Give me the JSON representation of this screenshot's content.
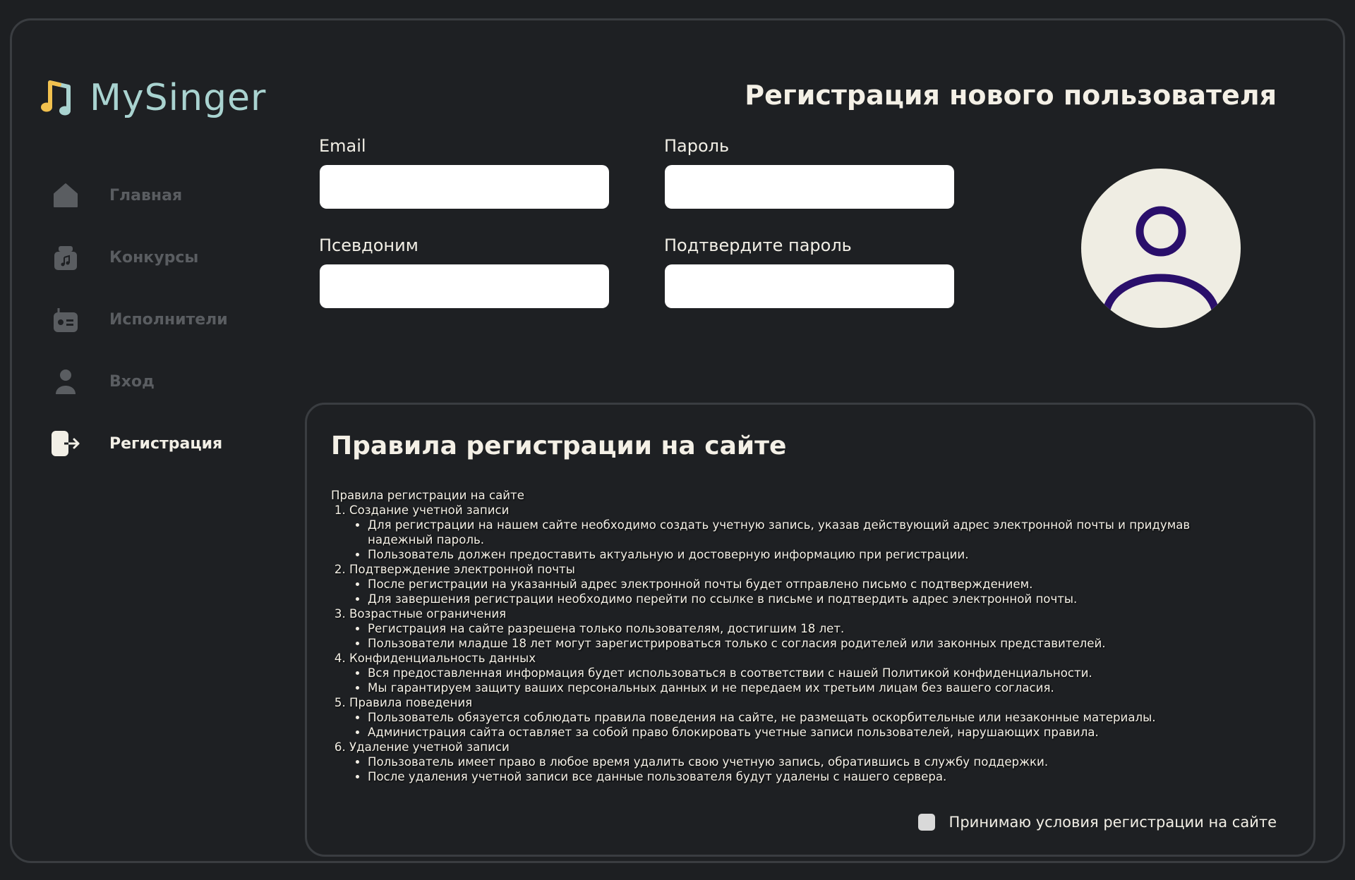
{
  "app": {
    "brand": "MySinger",
    "page_title": "Регистрация нового пользователя"
  },
  "nav": {
    "items": [
      {
        "label": "Главная",
        "icon": "home-icon",
        "active": false
      },
      {
        "label": "Конкурсы",
        "icon": "contest-icon",
        "active": false
      },
      {
        "label": "Исполнители",
        "icon": "radio-icon",
        "active": false
      },
      {
        "label": "Вход",
        "icon": "user-icon",
        "active": false
      },
      {
        "label": "Регистрация",
        "icon": "logout-arrow-icon",
        "active": true
      }
    ]
  },
  "form": {
    "email_label": "Email",
    "email_value": "",
    "password_label": "Пароль",
    "password_value": "",
    "nickname_label": "Псевдоним",
    "nickname_value": "",
    "confirm_label": "Подтвердите пароль",
    "confirm_value": ""
  },
  "rules": {
    "title": "Правила регистрации на сайте",
    "intro": "Правила регистрации на сайте",
    "sections": [
      {
        "heading": "Создание учетной записи",
        "points": [
          "Для регистрации на нашем сайте необходимо создать учетную запись, указав действующий адрес электронной почты и придумав надежный пароль.",
          "Пользователь должен предоставить актуальную и достоверную информацию при регистрации."
        ]
      },
      {
        "heading": "Подтверждение электронной почты",
        "points": [
          "После регистрации на указанный адрес электронной почты будет отправлено письмо с подтверждением.",
          "Для завершения регистрации необходимо перейти по ссылке в письме и подтвердить адрес электронной почты."
        ]
      },
      {
        "heading": "Возрастные ограничения",
        "points": [
          "Регистрация на сайте разрешена только пользователям, достигшим 18 лет.",
          "Пользователи младше 18 лет могут зарегистрироваться только с согласия родителей или законных представителей."
        ]
      },
      {
        "heading": "Конфиденциальность данных",
        "points": [
          "Вся предоставленная информация будет использоваться в соответствии с нашей Политикой конфиденциальности.",
          "Мы гарантируем защиту ваших персональных данных и не передаем их третьим лицам без вашего согласия."
        ]
      },
      {
        "heading": "Правила поведения",
        "points": [
          "Пользователь обязуется соблюдать правила поведения на сайте, не размещать оскорбительные или незаконные материалы.",
          "Администрация сайта оставляет за собой право блокировать учетные записи пользователей, нарушающих правила."
        ]
      },
      {
        "heading": "Удаление учетной записи",
        "points": [
          "Пользователь имеет право в любое время удалить свою учетную запись, обратившись в службу поддержки.",
          "После удаления учетной записи все данные пользователя будут удалены с нашего сервера."
        ]
      }
    ],
    "accept_label": "Принимаю условия регистрации на сайте",
    "accept_checked": false
  },
  "colors": {
    "background": "#1d1f22",
    "brand": "#a9d3d0",
    "logo_note": "#f2c14e",
    "avatar_bg": "#efede3",
    "avatar_icon": "#2a0f6b",
    "nav_inactive": "#5a5d61",
    "text": "#f2efe6"
  }
}
